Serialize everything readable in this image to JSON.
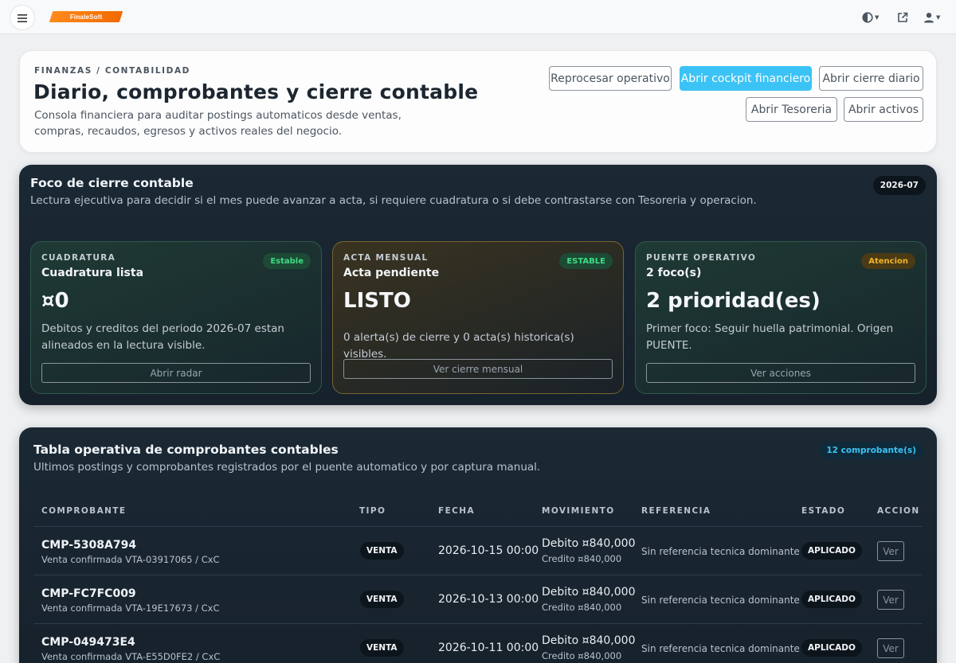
{
  "brand": {
    "logo_text": "FinaleSoft"
  },
  "topbar": {
    "icons": [
      "menu-icon",
      "theme-contrast-icon",
      "external-link-icon",
      "user-icon"
    ]
  },
  "header": {
    "eyebrow": "FINANZAS / CONTABILIDAD",
    "title": "Diario, comprobantes y cierre contable",
    "subtitle": "Consola financiera para auditar postings automaticos desde ventas, compras, recaudos, egresos y activos reales del negocio.",
    "buttons": {
      "reprocess": "Reprocesar operativo",
      "cockpit": "Abrir cockpit financiero",
      "daily_close": "Abrir cierre diario",
      "treasury": "Abrir Tesoreria",
      "assets": "Abrir activos"
    }
  },
  "focus": {
    "title": "Foco de cierre contable",
    "subtitle": "Lectura ejecutiva para decidir si el mes puede avanzar a acta, si requiere cuadratura o si debe contrastarse con Tesoreria y operacion.",
    "period": "2026-07",
    "cards": [
      {
        "eyebrow": "CUADRATURA",
        "label": "Cuadratura lista",
        "value": "¤0",
        "description": "Debitos y creditos del periodo 2026-07 estan alineados en la lectura visible.",
        "chip": "Estable",
        "button": "Abrir radar"
      },
      {
        "eyebrow": "ACTA MENSUAL",
        "label": "Acta pendiente",
        "value": "LISTO",
        "description": "0 alerta(s) de cierre y 0 acta(s) historica(s) visibles.",
        "chip": "ESTABLE",
        "button": "Ver cierre mensual"
      },
      {
        "eyebrow": "PUENTE OPERATIVO",
        "label": "2 foco(s)",
        "value": "2 prioridad(es)",
        "description": "Primer foco: Seguir huella patrimonial. Origen PUENTE.",
        "chip": "Atencion",
        "button": "Ver acciones"
      }
    ]
  },
  "table": {
    "title": "Tabla operativa de comprobantes contables",
    "subtitle": "Ultimos postings y comprobantes registrados por el puente automatico y por captura manual.",
    "count": "12 comprobante(s)",
    "columns": [
      "COMPROBANTE",
      "TIPO",
      "FECHA",
      "MOVIMIENTO",
      "REFERENCIA",
      "ESTADO",
      "ACCION"
    ],
    "rows": [
      {
        "code": "CMP-5308A794",
        "desc": "Venta confirmada VTA-03917065 / CxC",
        "type": "VENTA",
        "date": "2026-10-15 00:00",
        "debit": "Debito ¤840,000",
        "credit": "Credito ¤840,000",
        "reference": "Sin referencia tecnica dominante",
        "state": "APLICADO",
        "action": "Ver"
      },
      {
        "code": "CMP-FC7FC009",
        "desc": "Venta confirmada VTA-19E17673 / CxC",
        "type": "VENTA",
        "date": "2026-10-13 00:00",
        "debit": "Debito ¤840,000",
        "credit": "Credito ¤840,000",
        "reference": "Sin referencia tecnica dominante",
        "state": "APLICADO",
        "action": "Ver"
      },
      {
        "code": "CMP-049473E4",
        "desc": "Venta confirmada VTA-E55D0FE2 / CxC",
        "type": "VENTA",
        "date": "2026-10-11 00:00",
        "debit": "Debito ¤840,000",
        "credit": "Credito ¤840,000",
        "reference": "Sin referencia tecnica dominante",
        "state": "APLICADO",
        "action": "Ver"
      }
    ]
  }
}
